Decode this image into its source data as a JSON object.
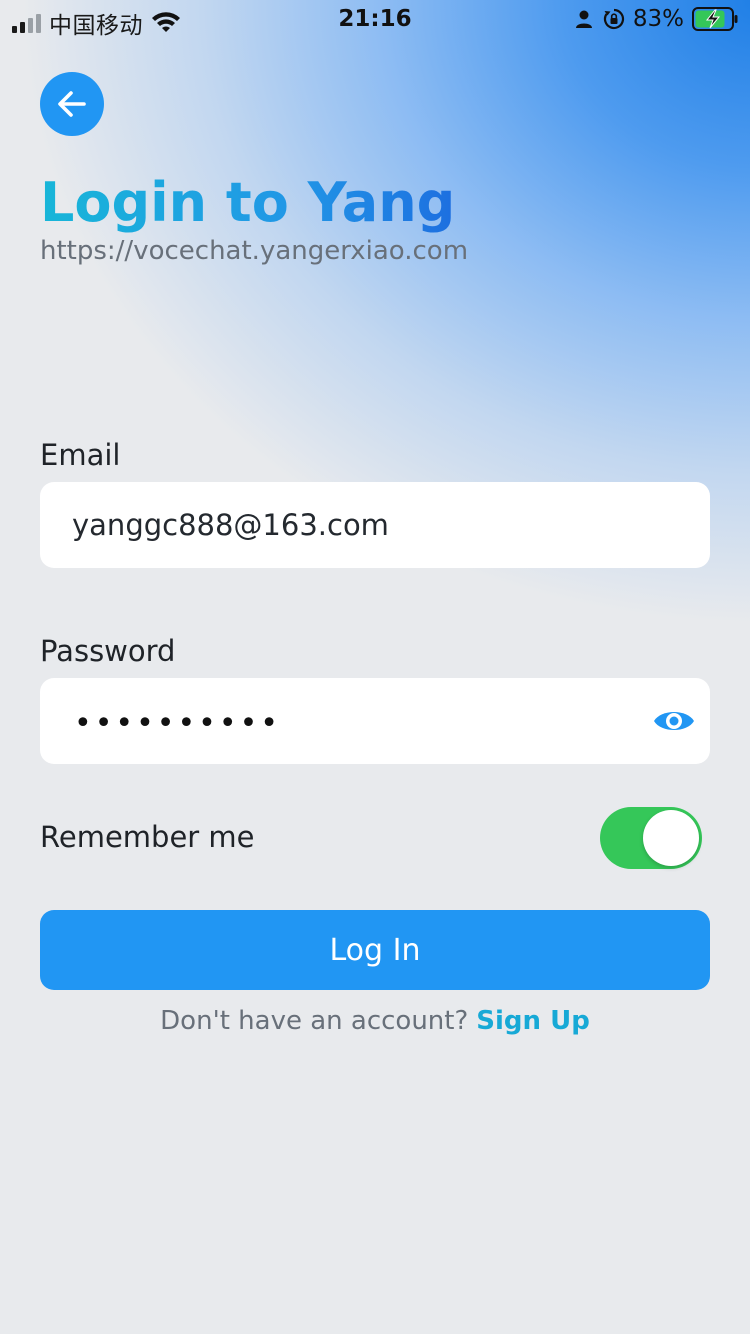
{
  "status_bar": {
    "carrier": "中国移动",
    "time": "21:16",
    "battery_percent": "83%",
    "battery_level": 0.83,
    "battery_charging": true,
    "icons": [
      "signal-icon",
      "wifi-icon",
      "person-icon",
      "orientation-lock-icon",
      "battery-icon"
    ]
  },
  "header": {
    "back_icon": "arrow-left-icon",
    "title": "Login to Yang",
    "subtitle": "https://vocechat.yangerxiao.com"
  },
  "form": {
    "email_label": "Email",
    "email_value": "yanggc888@163.com",
    "password_label": "Password",
    "password_masked": "••••••••••",
    "password_icon": "eye-icon",
    "remember_label": "Remember me",
    "remember_on": true,
    "login_label": "Log In"
  },
  "footer": {
    "prompt": "Don't have an account?",
    "signup_label": "Sign Up"
  },
  "colors": {
    "accent": "#2196f3",
    "toggle_on": "#35c759",
    "link": "#17a9d6",
    "background": "#e8eaed"
  }
}
